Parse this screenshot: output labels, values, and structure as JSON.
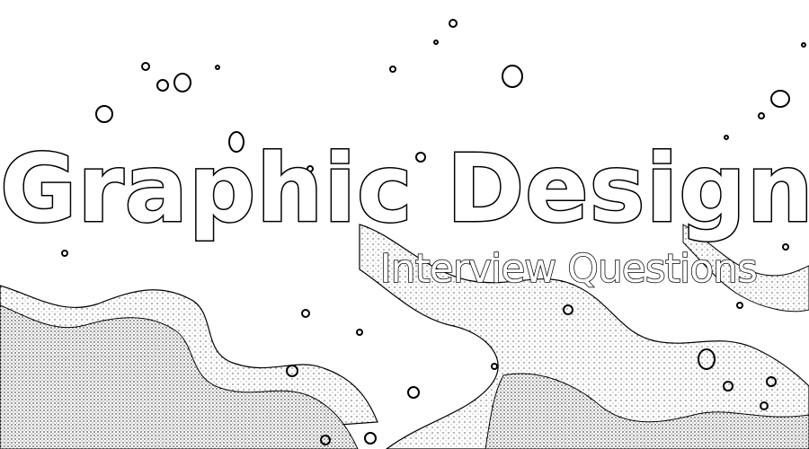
{
  "banner": {
    "title": "Graphic Design",
    "subtitle": "Interview Questions"
  },
  "colors": {
    "background": "#ffffff",
    "ink": "#000000",
    "title_fill": "#ffffff"
  },
  "icons": [
    "bubble-outline-icon"
  ]
}
